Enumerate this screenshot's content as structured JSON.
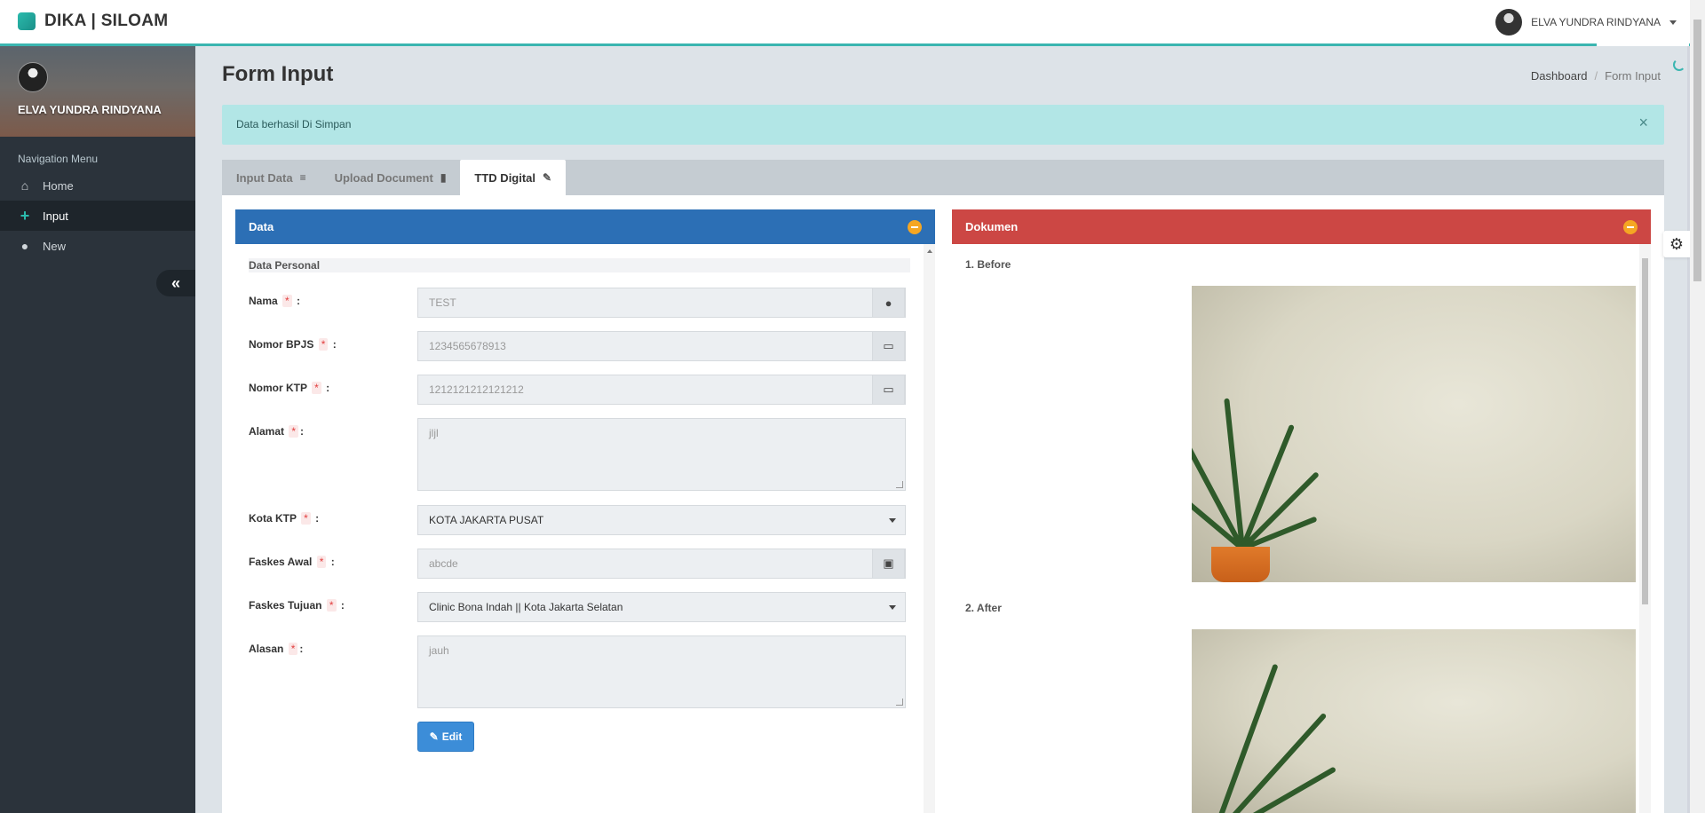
{
  "app": {
    "brand": "DIKA | SILOAM",
    "user_name": "ELVA YUNDRA RINDYANA"
  },
  "sidebar": {
    "profile_name": "ELVA YUNDRA RINDYANA",
    "nav_header": "Navigation Menu",
    "items": [
      {
        "label": "Home",
        "icon": "home-icon"
      },
      {
        "label": "Input",
        "icon": "plus-icon"
      },
      {
        "label": "New",
        "icon": "user-icon"
      }
    ]
  },
  "page": {
    "title": "Form Input",
    "breadcrumb": [
      "Dashboard",
      "Form Input"
    ]
  },
  "alert": {
    "message": "Data berhasil Di Simpan",
    "close": "×"
  },
  "tabs": [
    {
      "label": "Input Data",
      "icon": "database-icon",
      "active": false
    },
    {
      "label": "Upload Document",
      "icon": "file-icon",
      "active": false
    },
    {
      "label": "TTD Digital",
      "icon": "pencil-icon",
      "active": true
    }
  ],
  "data_panel": {
    "title": "Data",
    "section": "Data Personal",
    "fields": {
      "nama": {
        "label": "Nama",
        "value": "TEST"
      },
      "bpjs": {
        "label": "Nomor BPJS",
        "value": "1234565678913"
      },
      "ktp": {
        "label": "Nomor KTP",
        "value": "1212121212121212"
      },
      "alamat": {
        "label": "Alamat",
        "value": "jljl"
      },
      "kota": {
        "label": "Kota KTP",
        "value": "KOTA JAKARTA PUSAT"
      },
      "faskes_awal": {
        "label": "Faskes Awal",
        "value": "abcde"
      },
      "faskes_tujuan": {
        "label": "Faskes Tujuan",
        "value": "Clinic Bona Indah || Kota Jakarta Selatan"
      },
      "alasan": {
        "label": "Alasan",
        "value": "jauh"
      }
    },
    "required_mark": "*",
    "colon": ":",
    "edit_button": "Edit"
  },
  "doc_panel": {
    "title": "Dokumen",
    "items": [
      "1. Before",
      "2. After"
    ]
  },
  "colors": {
    "accent": "#3ab5b0",
    "data_header": "#2c6fb5",
    "doc_header": "#cc4744",
    "collapse": "#f5a623"
  }
}
